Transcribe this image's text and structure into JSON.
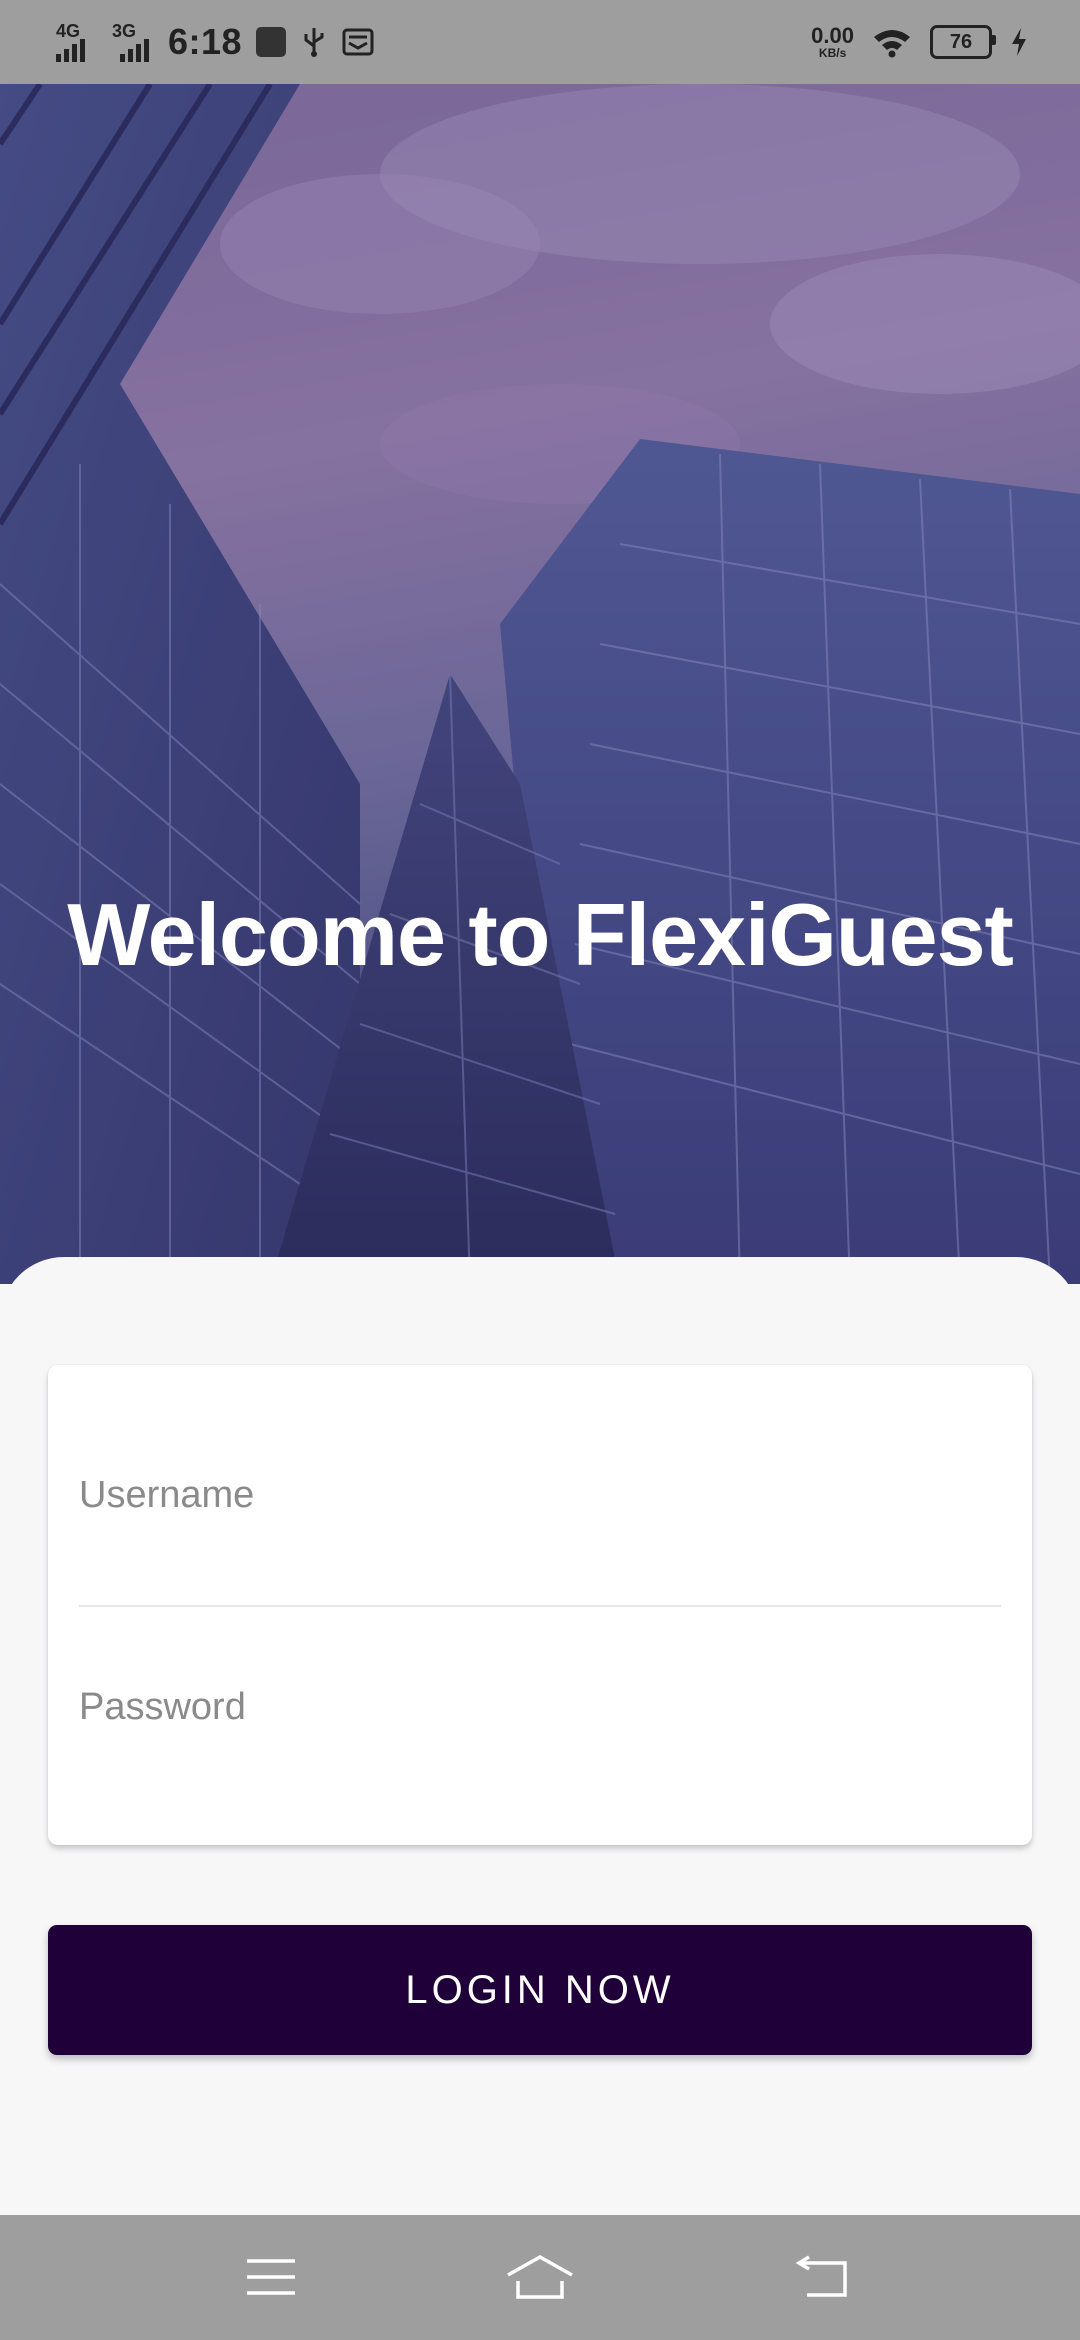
{
  "status_bar": {
    "network_1": "4G",
    "network_2": "3G",
    "time": "6:18",
    "speed_value": "0.00",
    "speed_unit": "KB/s",
    "battery": "76",
    "icons": [
      "signal-icon",
      "usb-debug-icon",
      "usb-icon",
      "message-icon",
      "wifi-icon",
      "battery-icon",
      "charging-icon"
    ]
  },
  "hero": {
    "title": "Welcome to FlexiGuest"
  },
  "login_form": {
    "username_placeholder": "Username",
    "username_value": "",
    "password_placeholder": "Password",
    "password_value": ""
  },
  "login_button": {
    "label": "LOGIN NOW"
  },
  "nav_bar": {
    "icons": [
      "menu-icon",
      "home-icon",
      "back-icon"
    ]
  },
  "colors": {
    "primary": "#200038",
    "sheet_background": "#f7f7f8",
    "system_bar": "#9e9e9e"
  }
}
